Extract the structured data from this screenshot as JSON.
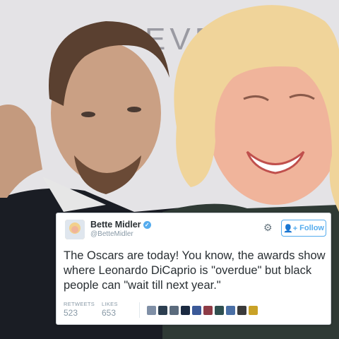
{
  "background": {
    "backdrop_text": "EVE",
    "colors": {
      "backdrop": "#e4e3e6",
      "suit": "#1a1d24",
      "hair_left": "#5a4030",
      "hair_right": "#f0d49a",
      "skin_left": "#caa084",
      "skin_right": "#f0b49b"
    }
  },
  "tweet": {
    "user": {
      "name": "Bette Midler",
      "handle": "@BetteMidler",
      "verified_icon": "verified-badge-icon"
    },
    "follow_label": "Follow",
    "settings_icon": "gear-icon",
    "text": "The Oscars are today! You know, the awards show where Leonardo DiCaprio is \"overdue\" but black people can \"wait till next year.\"",
    "stats": [
      {
        "label": "RETWEETS",
        "value": "523"
      },
      {
        "label": "LIKES",
        "value": "653"
      }
    ],
    "likers": [
      "#7f8fa6",
      "#2c3e50",
      "#5b6b7d",
      "#1b2a41",
      "#3b5998",
      "#8e3b46",
      "#2f4f4f",
      "#4a6fa5",
      "#3a3a3a",
      "#c9a227"
    ],
    "accent_color": "#55acee"
  }
}
